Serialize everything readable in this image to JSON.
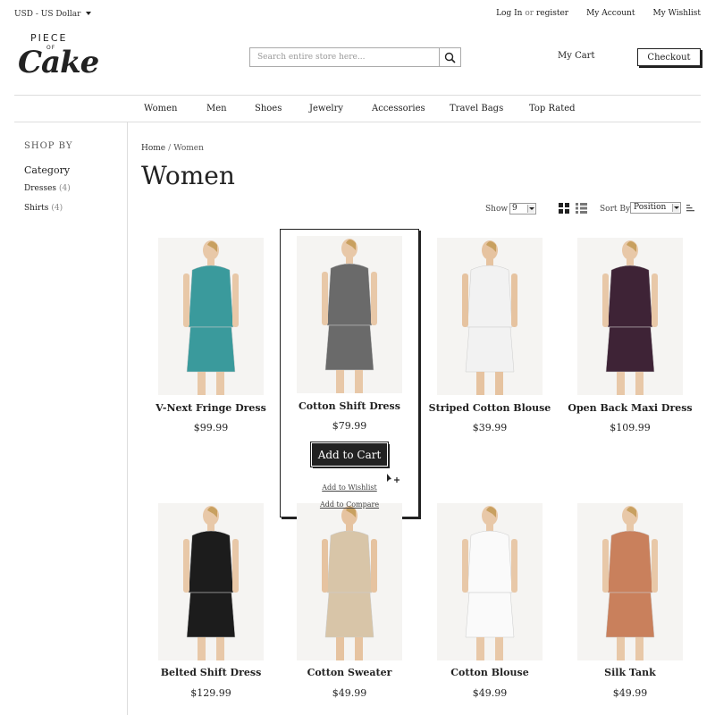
{
  "topbar": {
    "currency": "USD - US Dollar",
    "login": "Log In",
    "or": "or",
    "register": "register",
    "account": "My Account",
    "wishlist": "My Wishlist"
  },
  "logo": {
    "piece": "PIECE",
    "of": "OF",
    "cake": "Cake"
  },
  "search": {
    "placeholder": "Search entire store here..."
  },
  "header": {
    "cart": "My Cart",
    "checkout": "Checkout"
  },
  "nav": [
    "Women",
    "Men",
    "Shoes",
    "Jewelry",
    "Accessories",
    "Travel Bags",
    "Top Rated"
  ],
  "sidebar": {
    "shop_by": "SHOP BY",
    "category": "Category",
    "filters": [
      {
        "label": "Dresses",
        "count": "(4)"
      },
      {
        "label": "Shirts",
        "count": "(4)"
      }
    ]
  },
  "breadcrumb": {
    "home": "Home",
    "sep": "/",
    "current": "Women"
  },
  "page_title": "Women",
  "toolbar": {
    "show_label": "Show",
    "show_value": "9",
    "sort_label": "Sort By",
    "sort_value": "Position"
  },
  "products": [
    {
      "name": "V-Next Fringe Dress",
      "price": "$99.99",
      "color": "#3a9a9c",
      "skin": "#e8c8a8"
    },
    {
      "name": "Cotton Shift Dress",
      "price": "$79.99",
      "color": "#6a6a6a",
      "skin": "#e8c8a8"
    },
    {
      "name": "Striped Cotton Blouse",
      "price": "$39.99",
      "color": "#f2f2f2",
      "skin": "#e6c3a0"
    },
    {
      "name": "Open Back Maxi Dress",
      "price": "$109.99",
      "color": "#3e2336",
      "skin": "#e8c8a8"
    },
    {
      "name": "Belted Shift Dress",
      "price": "$129.99",
      "color": "#1c1c1c",
      "skin": "#e8c8a8"
    },
    {
      "name": "Cotton Sweater",
      "price": "$49.99",
      "color": "#d8c5a8",
      "skin": "#e6c3a0"
    },
    {
      "name": "Cotton Blouse",
      "price": "$49.99",
      "color": "#fafafa",
      "skin": "#e8c8a8"
    },
    {
      "name": "Silk Tank",
      "price": "$49.99",
      "color": "#c9805c",
      "skin": "#e8c8a8"
    }
  ],
  "hover_actions": {
    "add_to_cart": "Add to Cart",
    "add_to_wishlist": "Add to Wishlist",
    "add_to_compare": "Add to Compare"
  },
  "colors": {
    "accent": "#222222",
    "border": "#dddddd"
  }
}
